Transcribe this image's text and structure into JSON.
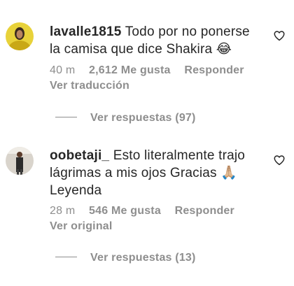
{
  "comments": [
    {
      "username": "lavalle1815",
      "text": "Todo por no ponerse la camisa que dice Shakira 😂",
      "time": "40 m",
      "likes": "2,612 Me gusta",
      "reply_label": "Responder",
      "translate_label": "Ver traducción",
      "view_replies": "Ver respuestas (97)",
      "avatar_icon": "avatar-photo-icon",
      "like_icon": "heart-outline-icon"
    },
    {
      "username": "oobetaji_",
      "text": "Esto literalmente trajo lágrimas a mis ojos Gracias 🙏🏼 Leyenda",
      "time": "28 m",
      "likes": "546 Me gusta",
      "reply_label": "Responder",
      "translate_label": "Ver original",
      "view_replies": "Ver respuestas (13)",
      "avatar_icon": "avatar-photo-icon",
      "like_icon": "heart-outline-icon"
    }
  ]
}
